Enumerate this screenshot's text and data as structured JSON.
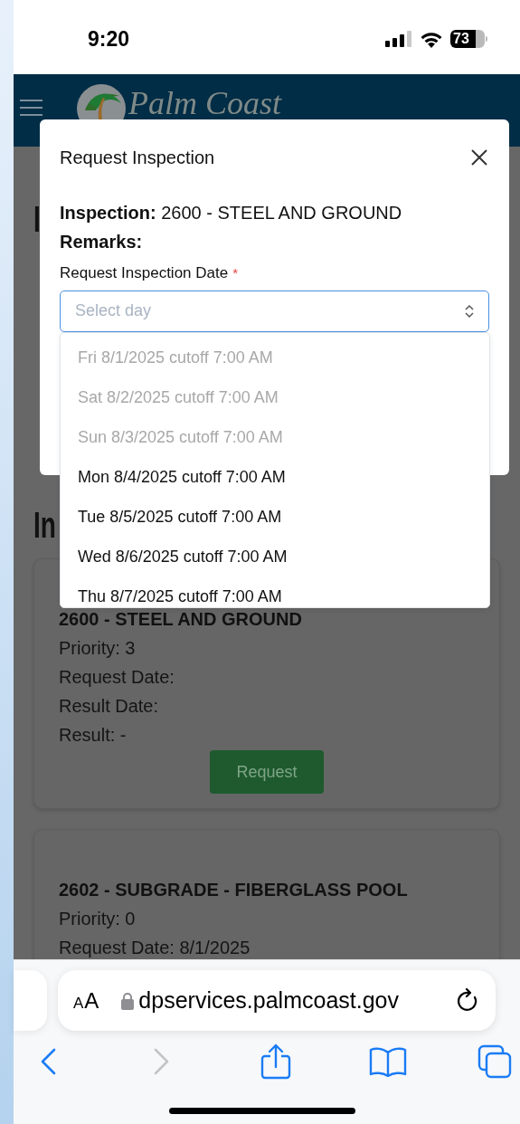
{
  "status_bar": {
    "time": "9:20",
    "battery": "73"
  },
  "header": {
    "logo_text": "Palm Coast"
  },
  "page": {
    "heading_1": "I",
    "heading_2": "In",
    "cards": [
      {
        "title": "2600 - STEEL AND GROUND",
        "lines": [
          "Priority: 3",
          "Request Date:",
          "Result Date:",
          "Result: -"
        ],
        "button": "Request"
      },
      {
        "title": "2602 - SUBGRADE - FIBERGLASS POOL",
        "lines": [
          "Priority: 0",
          "Request Date: 8/1/2025"
        ]
      }
    ]
  },
  "modal": {
    "title": "Request Inspection",
    "inspection_label": "Inspection:",
    "inspection_value": "2600 - STEEL AND GROUND",
    "remarks_label": "Remarks:",
    "date_label": "Request Inspection Date",
    "required_mark": "*",
    "select": {
      "placeholder": "Select day",
      "options": [
        {
          "label": "Fri 8/1/2025 cutoff 7:00 AM",
          "disabled": true
        },
        {
          "label": "Sat 8/2/2025 cutoff 7:00 AM",
          "disabled": true
        },
        {
          "label": "Sun 8/3/2025 cutoff 7:00 AM",
          "disabled": true
        },
        {
          "label": "Mon 8/4/2025 cutoff 7:00 AM",
          "disabled": false
        },
        {
          "label": "Tue 8/5/2025 cutoff 7:00 AM",
          "disabled": false
        },
        {
          "label": "Wed 8/6/2025 cutoff 7:00 AM",
          "disabled": false
        },
        {
          "label": "Thu 8/7/2025 cutoff 7:00 AM",
          "disabled": false
        }
      ]
    }
  },
  "browser": {
    "text_size_button": "AA",
    "url": "dpservices.palmcoast.gov",
    "forward_disabled": true
  }
}
